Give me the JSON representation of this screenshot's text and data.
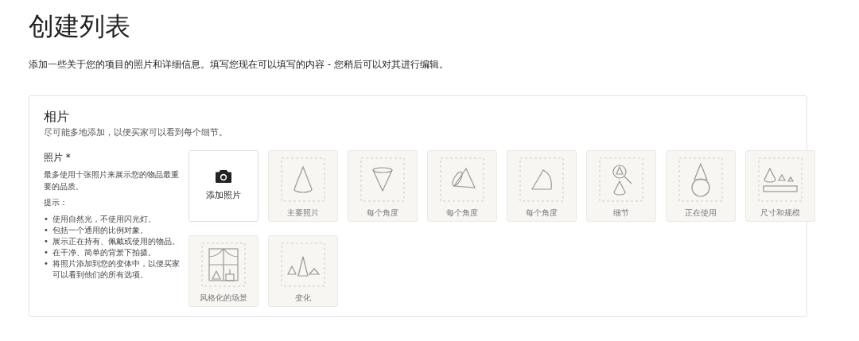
{
  "page": {
    "title": "创建列表",
    "description": "添加一些关于您的项目的照片和详细信息。填写您现在可以填写的内容 - 您稍后可以对其进行编辑。"
  },
  "section": {
    "title": "相片",
    "subtitle": "尽可能多地添加，以便买家可以看到每个细节。",
    "photos_label": "照片 *",
    "photos_help": "最多使用十张照片来展示您的物品最重要的品质。",
    "tips_label": "提示：",
    "tips": [
      {
        "bullet": "•",
        "text": "使用自然光，不使用闪光灯。"
      },
      {
        "bullet": "•",
        "text": "包括一个通用的比例对象。"
      },
      {
        "bullet": "•",
        "text": "展示正在持有、佩戴或使用的物品。"
      },
      {
        "bullet": "•",
        "text": "在干净、简单的背景下拍摄。"
      },
      {
        "bullet": "•",
        "text": "将照片添加到您的变体中，以便买家可以看到他们的所有选项。"
      }
    ],
    "add_button": "添加照片",
    "slots": [
      {
        "label": "主要照片",
        "kind": "cone"
      },
      {
        "label": "每个角度",
        "kind": "inverted"
      },
      {
        "label": "每个角度",
        "kind": "tilted"
      },
      {
        "label": "每个角度",
        "kind": "side"
      },
      {
        "label": "细节",
        "kind": "detail"
      },
      {
        "label": "正在使用",
        "kind": "wearing"
      },
      {
        "label": "尺寸和规模",
        "kind": "scale"
      },
      {
        "label": "风格化的场景",
        "kind": "scene"
      },
      {
        "label": "变化",
        "kind": "variations"
      }
    ]
  }
}
